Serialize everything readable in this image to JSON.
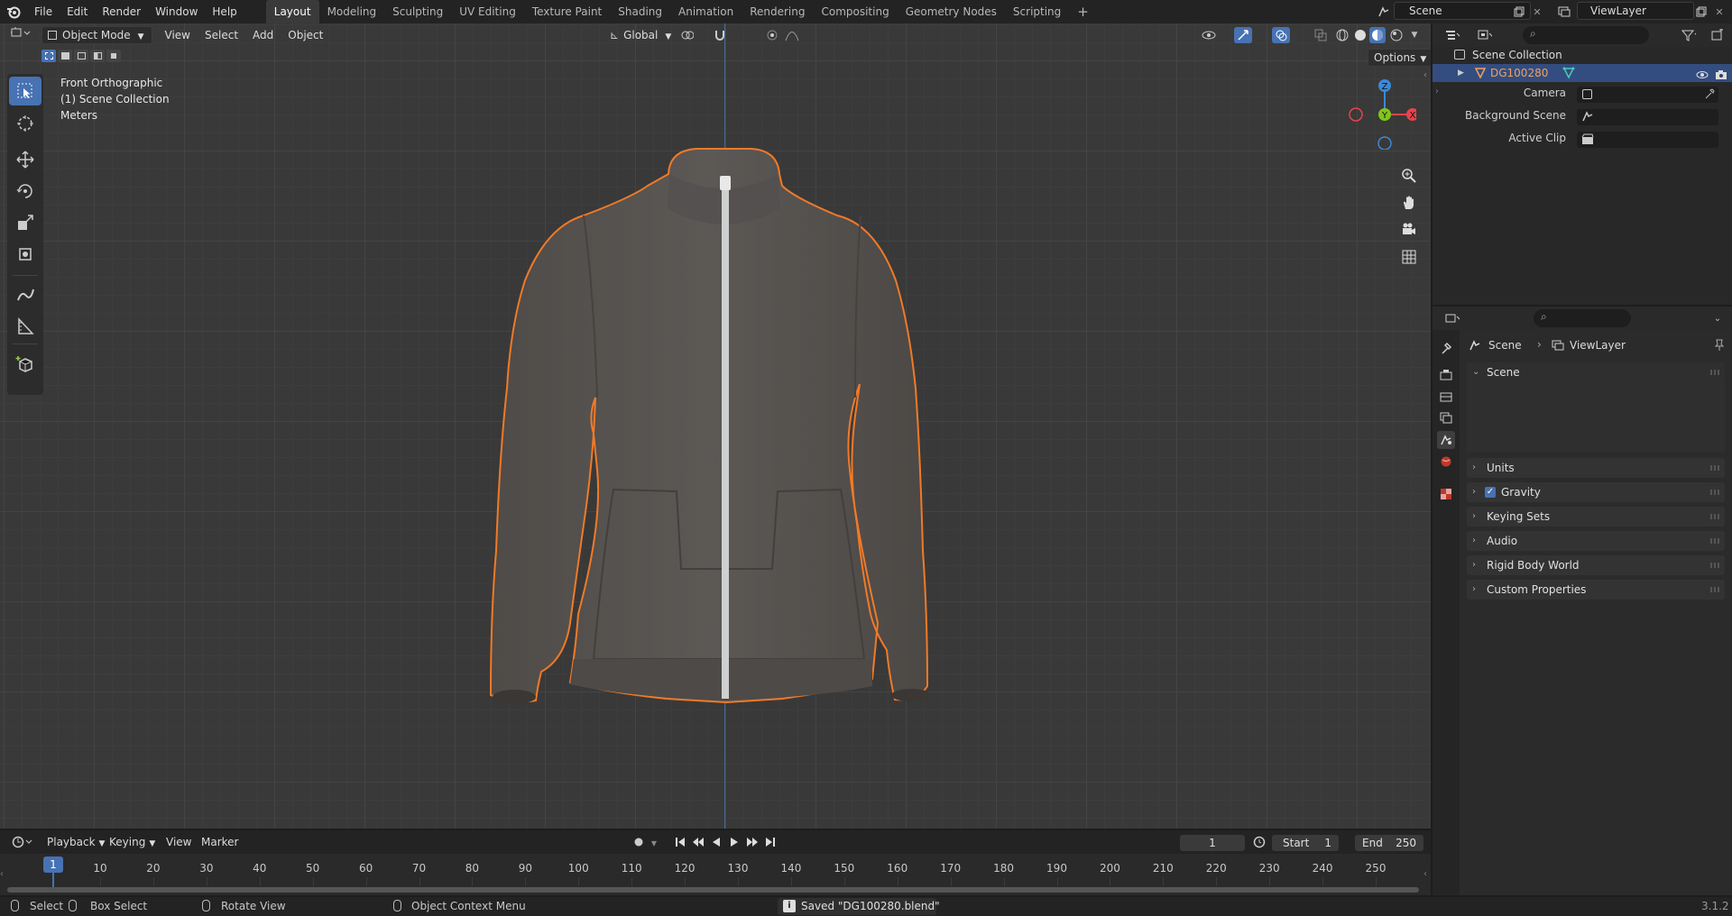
{
  "topbar": {
    "menus": [
      "File",
      "Edit",
      "Render",
      "Window",
      "Help"
    ],
    "workspaces": [
      "Layout",
      "Modeling",
      "Sculpting",
      "UV Editing",
      "Texture Paint",
      "Shading",
      "Animation",
      "Rendering",
      "Compositing",
      "Geometry Nodes",
      "Scripting"
    ],
    "active_workspace": "Layout",
    "add_workspace": "+",
    "scene_name": "Scene",
    "view_layer_name": "ViewLayer"
  },
  "viewport": {
    "mode": "Object Mode",
    "menus": [
      "View",
      "Select",
      "Add",
      "Object"
    ],
    "transform_orientation": "Global",
    "options_label": "Options",
    "overlay": {
      "view_name": "Front Orthographic",
      "collection": "(1) Scene Collection",
      "units": "Meters"
    },
    "gizmo": {
      "z": "Z",
      "y": "Y",
      "x": "X"
    }
  },
  "outliner": {
    "root": "Scene Collection",
    "objects": [
      {
        "name": "DG100280"
      }
    ]
  },
  "properties": {
    "breadcrumb": [
      "Scene",
      "ViewLayer"
    ],
    "panel_title": "Scene",
    "fields": [
      {
        "label": "Camera"
      },
      {
        "label": "Background Scene"
      },
      {
        "label": "Active Clip"
      }
    ],
    "subpanels": [
      "Units",
      "Gravity",
      "Keying Sets",
      "Audio",
      "Rigid Body World",
      "Custom Properties"
    ],
    "gravity_checked": true
  },
  "timeline": {
    "menus": [
      "Playback",
      "Keying",
      "View",
      "Marker"
    ],
    "current_frame": "1",
    "start_label": "Start",
    "start_value": "1",
    "end_label": "End",
    "end_value": "250",
    "ticks": [
      "1",
      "10",
      "20",
      "30",
      "40",
      "50",
      "60",
      "70",
      "80",
      "90",
      "100",
      "110",
      "120",
      "130",
      "140",
      "150",
      "160",
      "170",
      "180",
      "190",
      "200",
      "210",
      "220",
      "230",
      "240",
      "250"
    ]
  },
  "statusbar": {
    "select": "Select",
    "box_select": "Box Select",
    "rotate_view": "Rotate View",
    "context_menu": "Object Context Menu",
    "message": "Saved \"DG100280.blend\"",
    "version": "3.1.2"
  },
  "colors": {
    "accent": "#4772b3",
    "selection_outline": "#f07a28",
    "object_name": "#f0a060",
    "x_axis": "#e8434b",
    "y_axis": "#7ec51e",
    "z_axis": "#3d88d6"
  }
}
